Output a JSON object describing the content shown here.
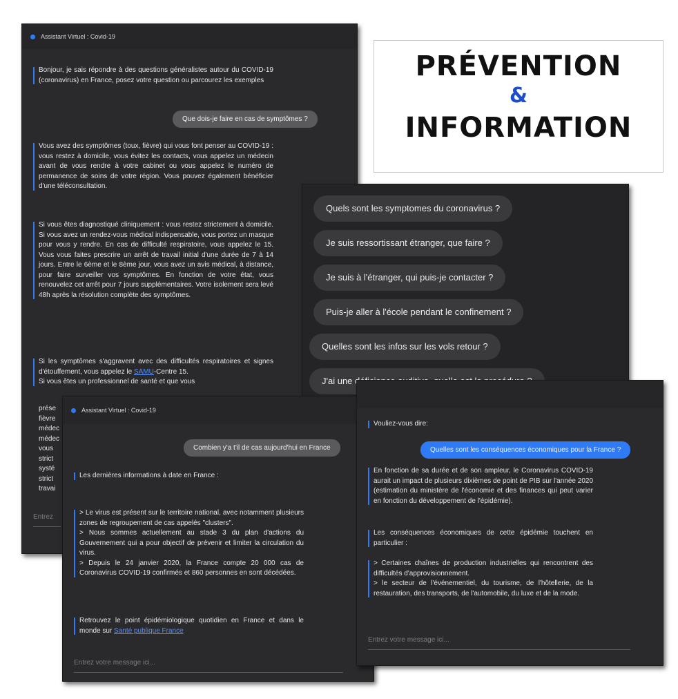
{
  "title": {
    "line1": "PRÉVENTION",
    "amp": "&",
    "line3": "INFORMATION"
  },
  "panel1": {
    "header": "Assistant Virtuel : Covid-19",
    "intro": "Bonjour, je sais répondre à des questions généralistes autour du COVID-19 (coronavirus) en France, posez votre question ou parcourez les exemples",
    "user_question": "Que dois-je faire en cas de symptômes ?",
    "answer1": "Vous avez des symptômes (toux, fièvre) qui vous font penser au COVID-19 : vous restez à domicile, vous évitez les contacts, vous appelez un médecin avant de vous rendre à votre cabinet ou vous appelez le numéro de permanence de soins de votre région. Vous pouvez également bénéficier d'une téléconsultation.",
    "answer2": "Si vous êtes diagnostiqué cliniquement : vous restez strictement à domicile. Si vous avez un rendez-vous médical indispensable, vous portez un masque pour vous y rendre. En cas de difficulté respiratoire, vous appelez le 15. Vous vous faites prescrire un arrêt de travail initial d'une durée de 7 à 14 jours. Entre le 6ème et le 8ème jour, vous avez un avis médical, à distance, pour faire surveiller vos symptômes. En fonction de votre état, vous renouvelez cet arrêt pour 7 jours supplémentaires. Votre isolement sera levé 48h après la résolution complète des symptômes.",
    "answer3_start": "Si les symptômes s'aggravent avec des difficultés respiratoires et signes d'étouffement, vous appelez le",
    "answer3_link": "SAMU",
    "answer3_end": "-Centre 15.",
    "answer3_partial": "Si vous êtes un professionnel de santé et que vous",
    "partial_lines": [
      "prése",
      "fièvre",
      "médec",
      "médec",
      "vous",
      "strict",
      "systé",
      "strict",
      "travai"
    ],
    "input_placeholder": "Entrez"
  },
  "suggestions": {
    "items": [
      "Quels sont les symptomes du coronavirus ?",
      "Je suis ressortissant étranger, que faire ?",
      "Je suis à l'étranger, qui puis-je contacter ?",
      "Puis-je aller à l'école pendant le confinement ?",
      "Quelles sont les infos sur les vols retour ?",
      "J'ai une déficience auditive, quelle est la procédure ?"
    ]
  },
  "panel2": {
    "header": "Assistant Virtuel : Covid-19",
    "user_question": "Combien y'a t'il de cas aujourd'hui en France",
    "answer_intro": "Les dernières informations à date en France :",
    "bullets": [
      "> Le virus est présent sur le territoire national, avec notamment plusieurs zones de regroupement de cas appelés \"clusters\".",
      "> Nous sommes actuellement au stade 3 du plan d'actions du Gouvernement qui a pour objectif de prévenir et limiter la circulation du virus.",
      "> Depuis le 24 janvier 2020, la France compte 20 000 cas de Coronavirus COVID-19 confirmés et 860 personnes en sont décédées."
    ],
    "footer_text": "Retrouvez le point épidémiologique quotidien en France et dans le monde sur",
    "footer_link": "Santé publique France",
    "input_placeholder": "Entrez votre message ici..."
  },
  "panel3": {
    "did_you_mean": "Vouliez-vous dire:",
    "user_question": "Quelles sont les conséquences économiques pour la France ?",
    "answer1": "En fonction de sa durée et de son ampleur, le Coronavirus COVID-19 aurait un impact de plusieurs dixièmes de point de PIB sur l'année 2020 (estimation du ministère de l'économie et des finances qui peut varier en fonction du développement de l'épidémie).",
    "answer2": "Les conséquences économiques de cette épidémie touchent en particulier :",
    "bullets": [
      "> Certaines chaînes de production industrielles qui rencontrent des difficultés d'approvisionnement.",
      "> le secteur de l'événementiel, du tourisme, de l'hôtellerie, de la restauration, des transports, de l'automobile, du luxe et de la mode."
    ],
    "input_placeholder": "Entrez votre message ici..."
  },
  "colors": {
    "accent": "#2f7bf5",
    "panel_bg": "#2a2a2c",
    "title_amp": "#1d4ec9"
  }
}
